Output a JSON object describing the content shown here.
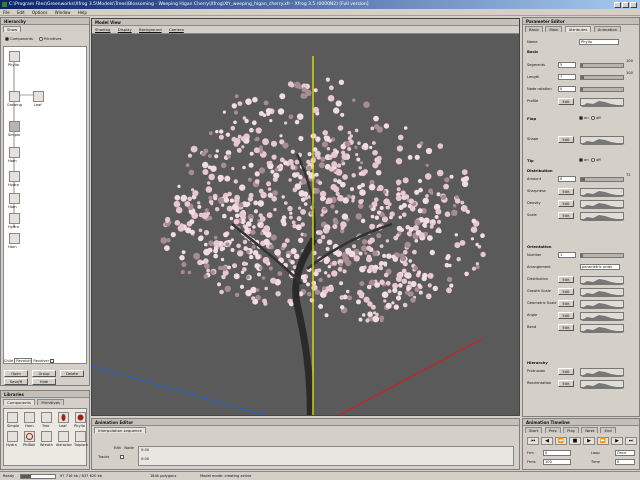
{
  "window": {
    "title": "C:\\Program Files\\Greenworks\\Xfrog 3.5\\Models\\Trees\\Blossoming - Weeping Higan Cherry\\Xfrog\\Xfr_weeping_higan_cherry.xfr - Xfrog 3.5 (0000N2) [Full version]"
  },
  "menu": [
    "File",
    "Edit",
    "Options",
    "Window",
    "Help"
  ],
  "hierarchy": {
    "header": "Hierarchy",
    "tab": "Show",
    "radio_components": "Components",
    "radio_primitives": "Primitives",
    "nodes": [
      "Phyllo",
      "Growing",
      "Leaf",
      "Simple",
      "Horn",
      "Hydra",
      "Horn",
      "Hydra",
      "Horn",
      "Tree"
    ],
    "filter_label": "Child",
    "filter_value": "Revolution",
    "filter_label2": "Revolver",
    "buttons": [
      "Open",
      "Group",
      "Delete",
      "Save/R",
      "Hide"
    ]
  },
  "library": {
    "header": "Libraries",
    "tabs": [
      "Components",
      "Primitives"
    ],
    "items_row1": [
      "Simple",
      "Horn",
      "Tree",
      "Leaf",
      "Phyllo"
    ],
    "items_row2": [
      "Hydra",
      "PhiBall",
      "Wreath",
      "Attractor",
      "Tropism"
    ]
  },
  "viewport": {
    "header": "Model View",
    "menu": [
      "Shading",
      "Display",
      "Background",
      "Camera"
    ]
  },
  "animation": {
    "header": "Animation Editor",
    "tab": "Interpolation sequence",
    "labels": [
      "Edit",
      "Node"
    ],
    "track_label": "Tracks",
    "key_start": "0:00",
    "key_end": "0:00"
  },
  "parameters": {
    "header": "Parameter Editor",
    "tabs": [
      "Basic",
      "Main",
      "Attributes",
      "Animation"
    ],
    "name_label": "Name",
    "name_value": "Phyllo",
    "sections": {
      "basic": "Basic",
      "spline": "Spline",
      "flap": "Flap",
      "distribution": "Distribution",
      "orientation": "Orientation",
      "hierarchy": "Hierarchy"
    },
    "rows": [
      {
        "label": "Segments",
        "value": "5",
        "max": "100",
        "fill": 0.05
      },
      {
        "label": "Length",
        "value": "7",
        "max": "100",
        "fill": 0.07
      },
      {
        "label": "Node rotation",
        "value": "0",
        "max": "",
        "fill": 0.0
      },
      {
        "label": "Profile",
        "value": "Edit",
        "max": "",
        "fill": 0.0
      },
      {
        "label": "Shape",
        "value": "Edit",
        "max": "",
        "fill": 0.0
      },
      {
        "label": "Amount",
        "value": "0",
        "max": "72",
        "fill": 0.1
      },
      {
        "label": "Sharpness",
        "value": "Edit",
        "max": "",
        "fill": 0.0
      },
      {
        "label": "Density",
        "value": "Edit",
        "max": "",
        "fill": 0.0
      },
      {
        "label": "Scale",
        "value": "Edit",
        "max": "",
        "fill": 0.0
      },
      {
        "label": "Number",
        "value": "1",
        "max": "",
        "fill": 0.0
      },
      {
        "label": "Arrangement",
        "value": "parametric order",
        "max": "",
        "fill": 0.0
      },
      {
        "label": "Distribution",
        "value": "Edit",
        "max": "",
        "fill": 0.0
      },
      {
        "label": "Growth Scale",
        "value": "Edit",
        "max": "",
        "fill": 0.0
      },
      {
        "label": "Geometric Scale",
        "value": "Edit",
        "max": "",
        "fill": 0.0
      },
      {
        "label": "Angle",
        "value": "Edit",
        "max": "",
        "fill": 0.0
      },
      {
        "label": "Bend",
        "value": "Edit",
        "max": "",
        "fill": 0.0
      },
      {
        "label": "Protrusion",
        "value": "Edit",
        "max": "",
        "fill": 0.0
      },
      {
        "label": "Reorientation",
        "value": "Edit",
        "max": "",
        "fill": 0.0
      }
    ],
    "flap_on": "on",
    "flap_off": "off",
    "tip_label": "Tip",
    "tip_on": "on",
    "tip_off": "off"
  },
  "timeline": {
    "header": "Animation Timeline",
    "tabs": [
      "Start",
      "Prev",
      "Play",
      "Next",
      "End"
    ],
    "frame_label": "Frm",
    "frame_value": "0",
    "fps_label": "Frms",
    "fps_value": "100",
    "loop_label": "Loop",
    "loop_value": "Once",
    "time_label": "Time",
    "time_value": "0"
  },
  "status": {
    "ready": "Ready",
    "memory": "97 716 kb / 837 620 kb",
    "polygons": "184k polygons",
    "mode": "Model mode: creating active"
  },
  "colors": {
    "blossom": "#e8c8d0",
    "viewport_bg": "#5a5a5a",
    "axis_y": "#e8e800",
    "axis_x": "#d02020",
    "axis_z": "#2060d0"
  }
}
